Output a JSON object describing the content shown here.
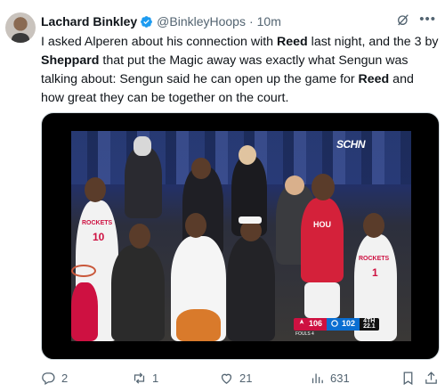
{
  "author": {
    "name": "Lachard Binkley",
    "handle": "@BinkleyHoops",
    "separator": "·",
    "time": "10m"
  },
  "post": {
    "text_parts": [
      {
        "t": "I asked Alperen about his connection with ",
        "b": false
      },
      {
        "t": "Reed",
        "b": true
      },
      {
        "t": " last night, and the 3 by ",
        "b": false
      },
      {
        "t": "Sheppard",
        "b": true
      },
      {
        "t": " that put the Magic away was exactly what Sengun was talking about: Sengun said he can open up the game for ",
        "b": false
      },
      {
        "t": "Reed",
        "b": true
      },
      {
        "t": " and how great they can be together on the court.",
        "b": false
      }
    ]
  },
  "video": {
    "broadcast_bug": "SCHN",
    "jersey_left_text": "ROCKETS",
    "jersey_left_number": "10",
    "jersey_right_text": "ROCKETS",
    "jersey_right_number": "1",
    "jersey_center_text": "HOU",
    "scoreboard": {
      "home_score": "106",
      "home_fouls": "FOULS 4",
      "away_score": "102",
      "period": "4TH",
      "clock": "22.1"
    }
  },
  "actions": {
    "replies": "2",
    "reposts": "1",
    "likes": "21",
    "views": "631"
  },
  "colors": {
    "verified": "#1d9bf0",
    "text_secondary": "#536471",
    "rockets_red": "#ce1141",
    "magic_blue": "#0a6ed1"
  },
  "icons": [
    "verified-badge-icon",
    "grok-icon",
    "more-icon",
    "reply-icon",
    "repost-icon",
    "like-icon",
    "views-icon",
    "bookmark-icon",
    "share-icon"
  ]
}
